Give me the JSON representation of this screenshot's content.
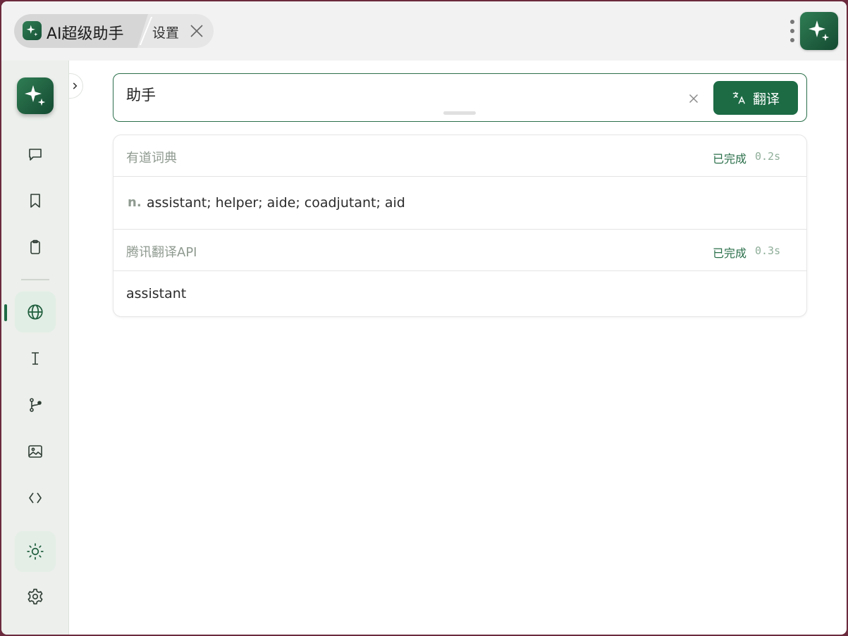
{
  "titlebar": {
    "app_title": "AI超级助手",
    "tab_label": "设置"
  },
  "sidebar": {
    "items": [
      {
        "name": "chat",
        "icon": "chat-bubble-icon"
      },
      {
        "name": "bookmark",
        "icon": "bookmark-icon"
      },
      {
        "name": "clipboard",
        "icon": "clipboard-icon"
      },
      {
        "name": "translate",
        "icon": "globe-icon",
        "active": true
      },
      {
        "name": "text",
        "icon": "text-cursor-icon"
      },
      {
        "name": "branch",
        "icon": "git-branch-icon"
      },
      {
        "name": "image",
        "icon": "image-icon"
      },
      {
        "name": "code",
        "icon": "code-icon"
      },
      {
        "name": "theme",
        "icon": "sun-icon"
      },
      {
        "name": "settings",
        "icon": "gear-icon"
      }
    ]
  },
  "search": {
    "value": "助手",
    "button_label": "翻译"
  },
  "results": [
    {
      "source": "有道词典",
      "status": "已完成",
      "time": "0.2s",
      "pos": "n.",
      "text": "assistant; helper; aide; coadjutant; aid"
    },
    {
      "source": "腾讯翻译API",
      "status": "已完成",
      "time": "0.3s",
      "text": "assistant"
    }
  ],
  "colors": {
    "accent": "#1c6b45",
    "accent_border": "#2a6f4a",
    "sidebar_bg": "#ecefeb"
  }
}
